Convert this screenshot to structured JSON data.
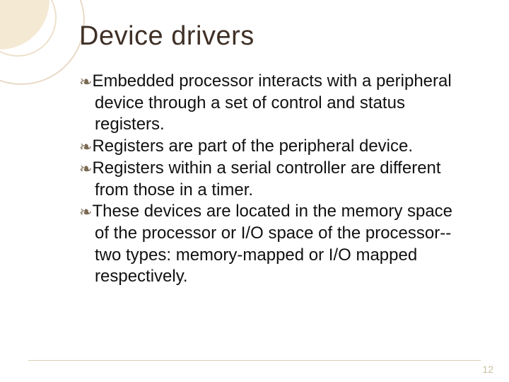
{
  "title": "Device drivers",
  "bullets": [
    "Embedded processor interacts with a peripheral device through a set of control and status registers.",
    "Registers are part of the peripheral device.",
    "Registers within a serial controller are different from those in a timer.",
    "These devices are located in the memory space of the processor or I/O space of the processor-- two types: memory-mapped or I/O mapped respectively."
  ],
  "bullet_glyph": "ɰ",
  "page_number": "12"
}
